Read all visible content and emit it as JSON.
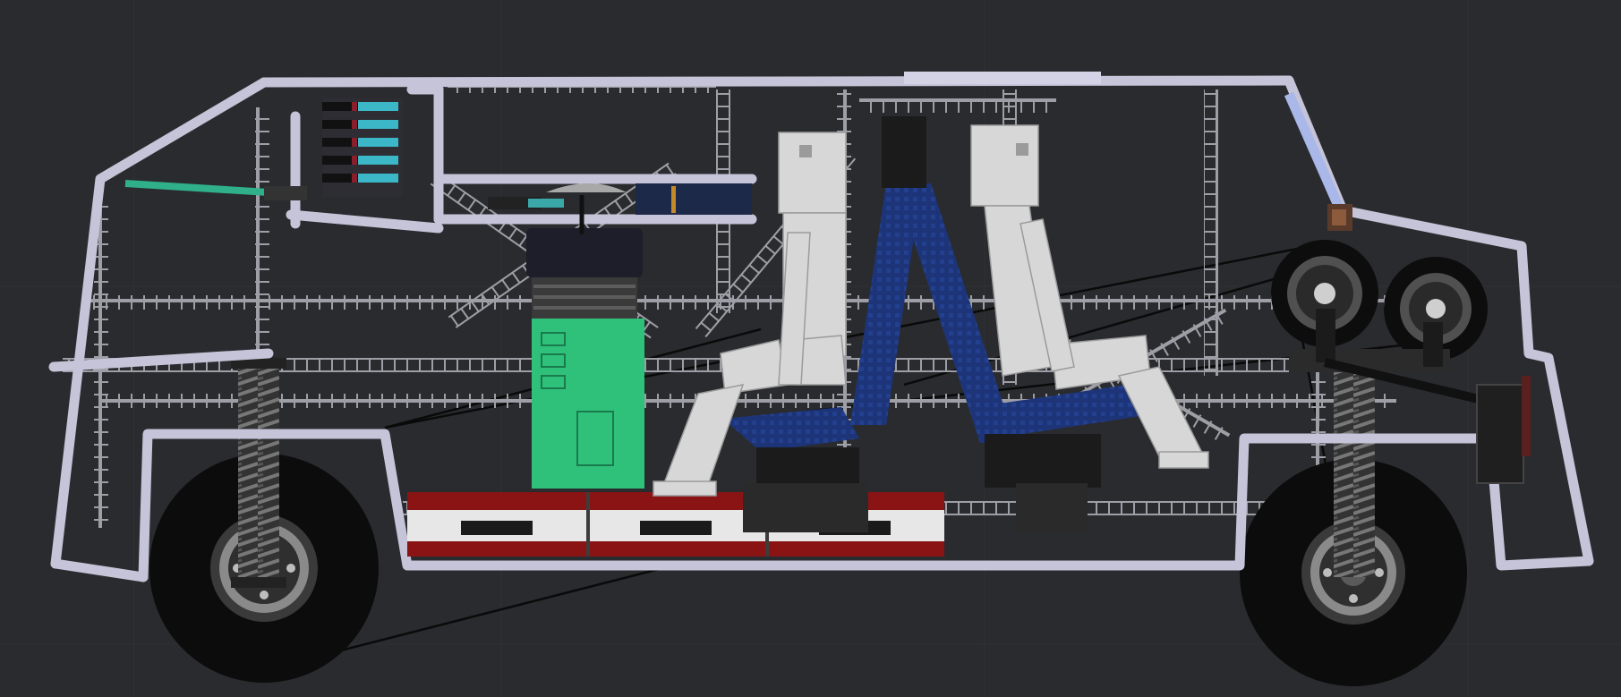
{
  "scene": {
    "background": "#2a2b2f",
    "frame_color": "#c5c4d8",
    "ladder_color": "#9e9ea6",
    "tire_color": "#0c0c0c",
    "spring_color": "#6a6a6a",
    "tank_color": "#2fc07a",
    "seat_color": "#1d3478",
    "ragdoll_color": "#d7d7d7",
    "battery_color": "#8a1414"
  }
}
